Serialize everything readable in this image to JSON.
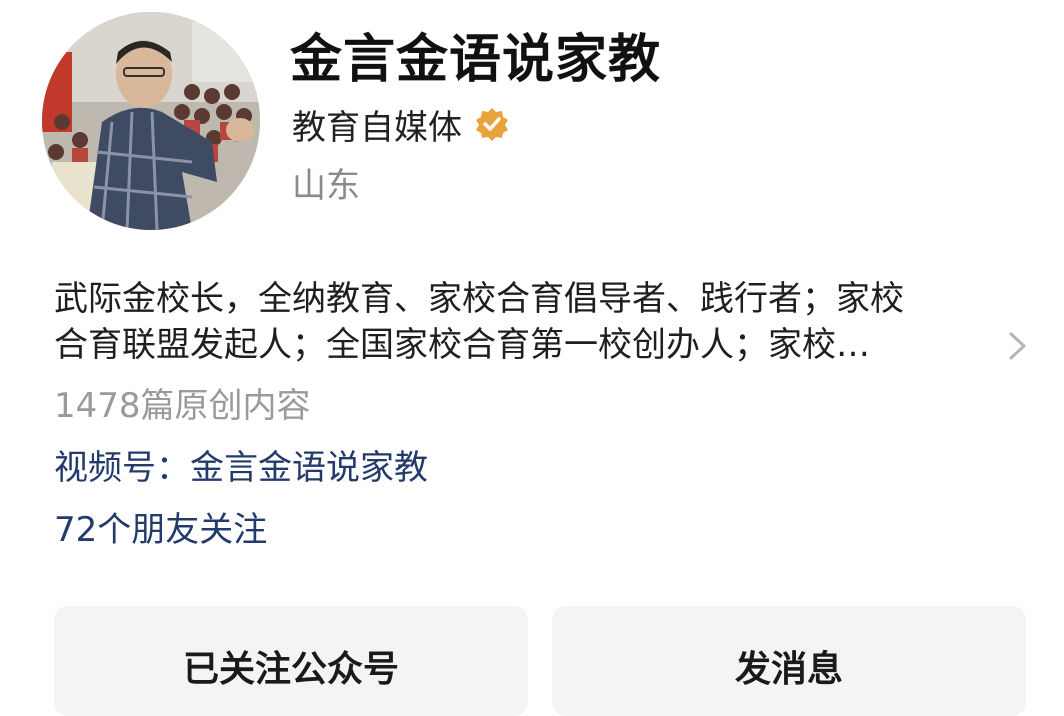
{
  "profile": {
    "name": "金言金语说家教",
    "subtitle": "教育自媒体",
    "region": "山东",
    "verified_icon": "verified-badge-icon",
    "verified_color": "#e8a33d"
  },
  "bio": {
    "line1": "武际金校长，全纳教育、家校合育倡导者、践行者；家校",
    "line2": "合育联盟发起人；全国家校合育第一校创办人；家校…"
  },
  "stats": {
    "article_count": "1478篇原创内容",
    "channel": "视频号：金言金语说家教",
    "friends_following": "72个朋友关注"
  },
  "actions": {
    "follow_label": "已关注公众号",
    "message_label": "发消息"
  },
  "colors": {
    "link": "#233a6b",
    "muted": "#9a9a9a",
    "button_bg": "#f4f4f4"
  }
}
